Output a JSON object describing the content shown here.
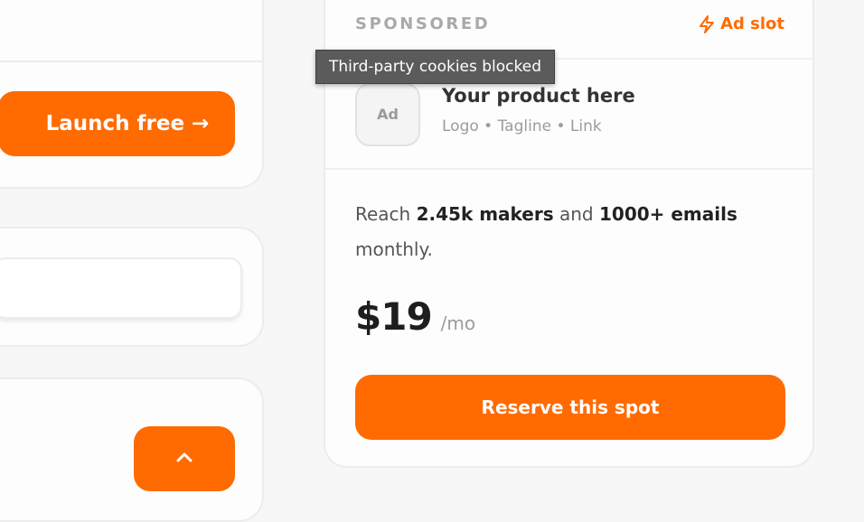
{
  "left_column": {
    "launch_button_label": "Launch free →"
  },
  "ad": {
    "sponsored_label": "SPONSORED",
    "slot_label": "Ad slot",
    "logo_label": "Ad",
    "product_title": "Your product here",
    "product_subtitle": "Logo • Tagline • Link",
    "reach": {
      "prefix": "Reach ",
      "makers": "2.45k makers",
      "middle": " and ",
      "emails": "1000+ emails",
      "suffix": " monthly."
    },
    "price": "$19",
    "price_period": "/mo",
    "reserve_button_label": "Reserve this spot"
  },
  "tooltip": {
    "text": "Third-party cookies blocked"
  },
  "icons": {
    "ad_slot": "lightning-bolt-icon",
    "scroll_top": "chevron-up-icon"
  },
  "colors": {
    "accent": "#ff6b00",
    "muted_text": "#a9a9a9",
    "tooltip_bg": "#5b5b5b"
  }
}
